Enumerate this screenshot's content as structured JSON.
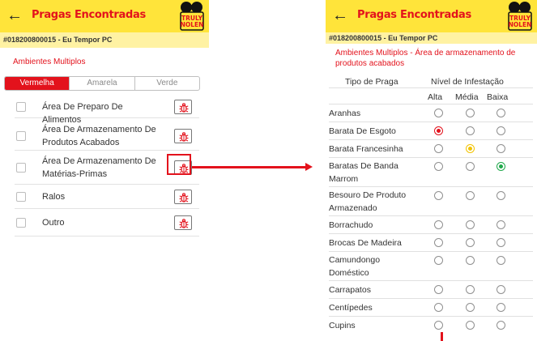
{
  "app": {
    "title": "Pragas Encontradas",
    "client_line": "#018200800015 - Eu Tempor PC",
    "logo_text": [
      "TRULY",
      "NOLEN"
    ],
    "icons": {
      "back": "arrow-left-icon",
      "pest": "bug-icon"
    }
  },
  "left": {
    "breadcrumb": "Ambientes Multiplos",
    "severity_tabs": [
      "Vermelha",
      "Amarela",
      "Verde"
    ],
    "selected_tab": "Vermelha",
    "environments": [
      {
        "label": "Área De Preparo De Alimentos",
        "checked": false
      },
      {
        "label": "Área De Armazenamento De Produtos Acabados",
        "checked": false
      },
      {
        "label": "Área De Armazenamento De Matérias-Primas",
        "checked": false,
        "highlighted": true
      },
      {
        "label": "Ralos",
        "checked": false
      },
      {
        "label": "Outro",
        "checked": false
      }
    ]
  },
  "right": {
    "breadcrumb": "Ambientes Multiplos - Área de armazenamento de produtos acabados",
    "headers": {
      "pest_type": "Tipo de Praga",
      "infestation_level": "Nível de Infestação",
      "levels": [
        "Alta",
        "Média",
        "Baixa"
      ]
    },
    "pests": [
      {
        "name": "Aranhas",
        "selected": null
      },
      {
        "name": "Barata De Esgoto",
        "selected": "Alta"
      },
      {
        "name": "Barata Francesinha",
        "selected": "Média"
      },
      {
        "name": "Baratas De Banda Marrom",
        "selected": "Baixa"
      },
      {
        "name": "Besouro De Produto Armazenado",
        "selected": null
      },
      {
        "name": "Borrachudo",
        "selected": null
      },
      {
        "name": "Brocas De Madeira",
        "selected": null
      },
      {
        "name": "Camundongo Doméstico",
        "selected": null
      },
      {
        "name": "Carrapatos",
        "selected": null
      },
      {
        "name": "Centípedes",
        "selected": null
      },
      {
        "name": "Cupins",
        "selected": null
      },
      {
        "name": "",
        "selected": null
      }
    ]
  },
  "colors": {
    "appbar": "#ffe43a",
    "accent_red": "#e3121c",
    "level_high": "#e3121c",
    "level_medium": "#f2c300",
    "level_low": "#1fa84a"
  }
}
